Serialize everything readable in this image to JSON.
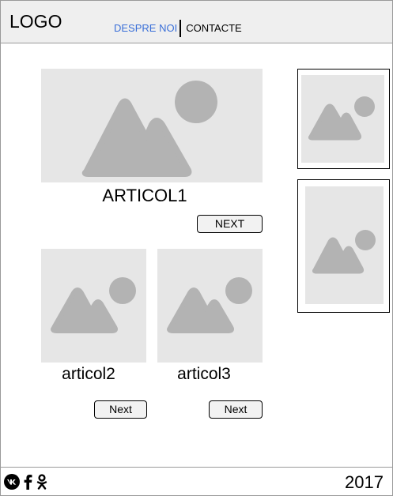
{
  "header": {
    "logo": "LOGO",
    "nav": [
      {
        "label": "DESPRE NOI"
      },
      {
        "label": "CONTACTE"
      }
    ]
  },
  "main": {
    "featured": {
      "title": "ARTICOL1",
      "button": "NEXT"
    },
    "articles": [
      {
        "title": "articol2",
        "button": "Next"
      },
      {
        "title": "articol3",
        "button": "Next"
      }
    ]
  },
  "footer": {
    "social": [
      "vk-icon",
      "facebook-icon",
      "odnoklassniki-icon"
    ],
    "year": "2017"
  },
  "colors": {
    "placeholder_bg": "#e6e6e6",
    "placeholder_shape": "#b3b3b3",
    "header_bg": "#efefef",
    "active_link": "#3a6fd8"
  }
}
